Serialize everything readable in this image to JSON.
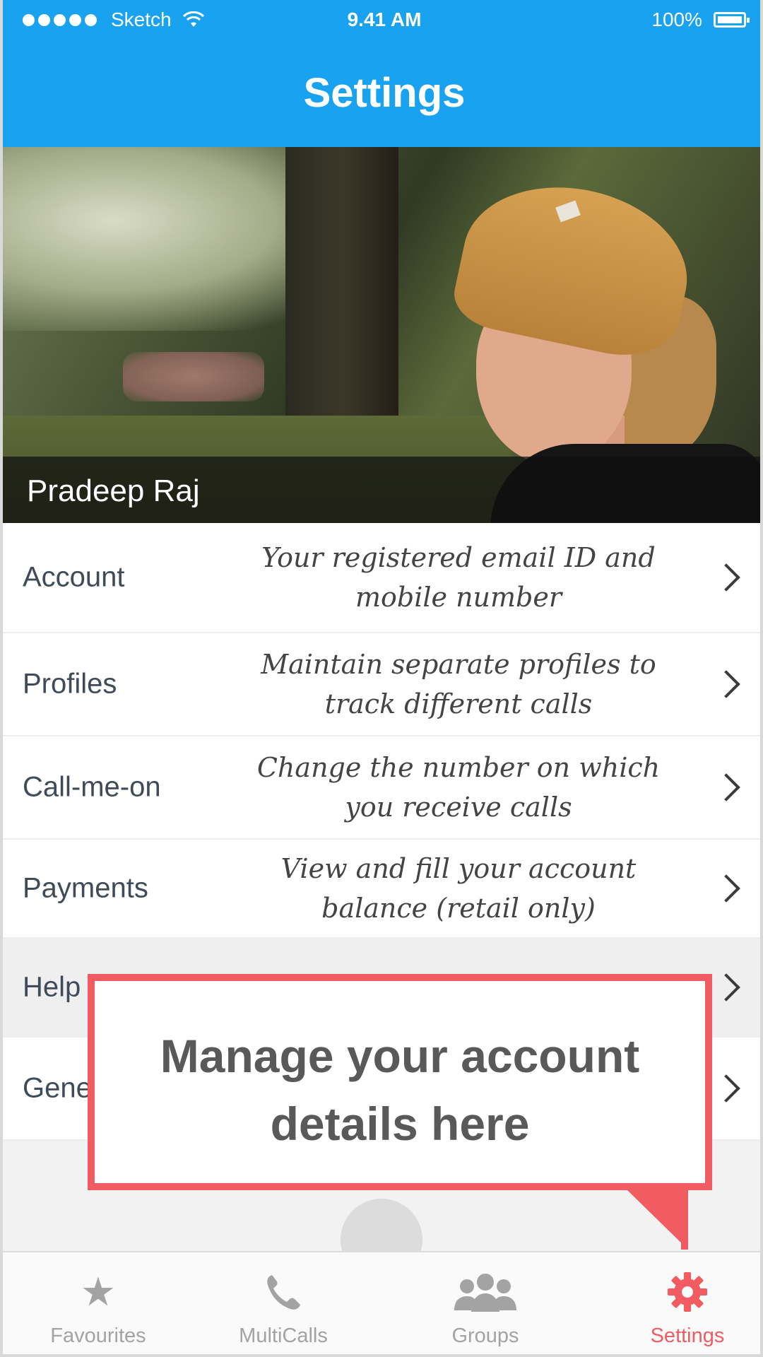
{
  "status_bar": {
    "carrier": "Sketch",
    "time": "9.41 AM",
    "battery": "100%"
  },
  "nav": {
    "title": "Settings"
  },
  "profile": {
    "name": "Pradeep Raj"
  },
  "settings_items": [
    {
      "label": "Account",
      "description": "Your registered email ID and mobile number"
    },
    {
      "label": "Profiles",
      "description": "Maintain separate profiles to track different calls"
    },
    {
      "label": "Call-me-on",
      "description": "Change the number on which you receive calls"
    },
    {
      "label": "Payments",
      "description": "View and fill your account balance (retail only)"
    },
    {
      "label": "Help",
      "description": ""
    },
    {
      "label": "Gene",
      "description": ""
    }
  ],
  "callout": {
    "text": "Manage your account details here",
    "border_color": "#f15c63"
  },
  "tabs": [
    {
      "label": "Favourites",
      "icon": "star-icon",
      "active": false
    },
    {
      "label": "MultiCalls",
      "icon": "phone-icon",
      "active": false
    },
    {
      "label": "Groups",
      "icon": "group-icon",
      "active": false
    },
    {
      "label": "Settings",
      "icon": "gear-icon",
      "active": true
    }
  ],
  "colors": {
    "primary": "#18a2ef",
    "accent": "#f15c63",
    "inactive_tab": "#a3a3a3"
  }
}
